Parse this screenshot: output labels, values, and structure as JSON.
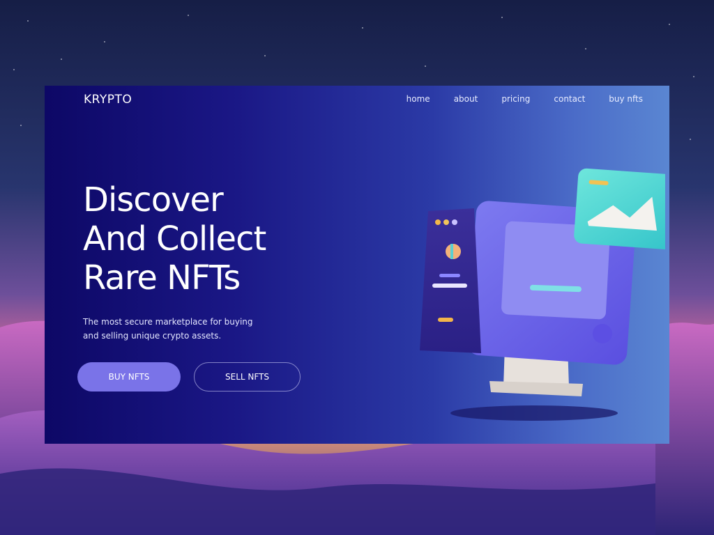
{
  "app": {
    "brand": "KRYPTO"
  },
  "nav": {
    "items": [
      "home",
      "about",
      "pricing",
      "contact",
      "buy nfts"
    ]
  },
  "hero": {
    "title_lines": [
      "Discover",
      "And Collect",
      "Rare NFTs"
    ],
    "subtitle": "The most secure marketplace for buying and selling unique crypto assets."
  },
  "buttons": {
    "buy_label": "BUY NFTS",
    "sell_label": "SELL NFTS"
  },
  "colors": {
    "accent": "#7a73e8",
    "card_start": "#0d0866",
    "card_end": "#5a86d2",
    "monitor_body": "#6d68e8",
    "image_card": "#4fd9d0"
  },
  "illustration": {
    "icon": "computer-monitor-illustration"
  }
}
